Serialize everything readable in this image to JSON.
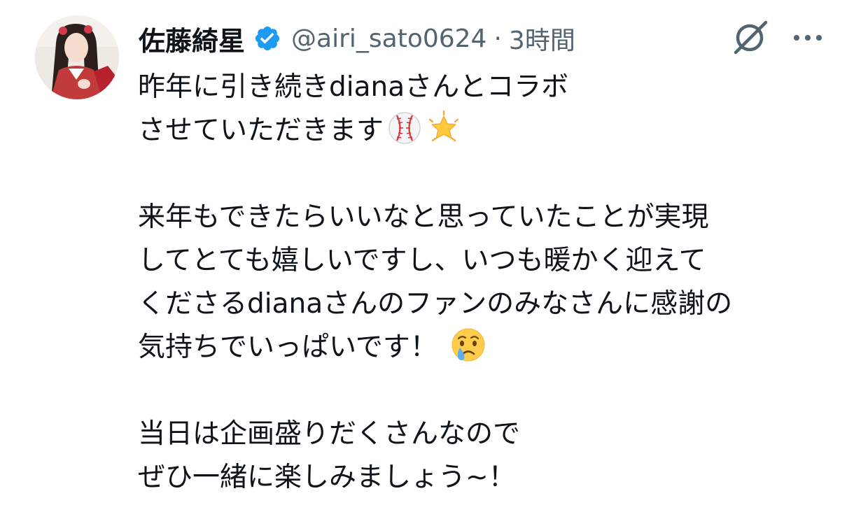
{
  "author": {
    "display_name": "佐藤綺星",
    "handle": "@airi_sato0624",
    "separator": "·",
    "time": "3時間",
    "verified": true
  },
  "icons": {
    "verified": "verified-badge-icon",
    "grok": "grok-icon",
    "more": "more-icon",
    "baseball": "baseball-emoji",
    "star": "glowing-star-emoji",
    "crying": "crying-face-emoji"
  },
  "colors": {
    "verified_blue": "#1d9bf0",
    "text": "#0f1419",
    "secondary_text": "#536471"
  },
  "tweet": {
    "lines": [
      "昨年に引き続きdianaさんとコラボ",
      "させていただきます",
      "",
      "来年もできたらいいなと思っていたことが実現",
      "してとても嬉しいですし、いつも暖かく迎えて",
      "くださるdianaさんのファンのみなさんに感謝の",
      "気持ちでいっぱいです！",
      "",
      "当日は企画盛りだくさんなので",
      "ぜひ一緒に楽しみましょう~！"
    ]
  }
}
